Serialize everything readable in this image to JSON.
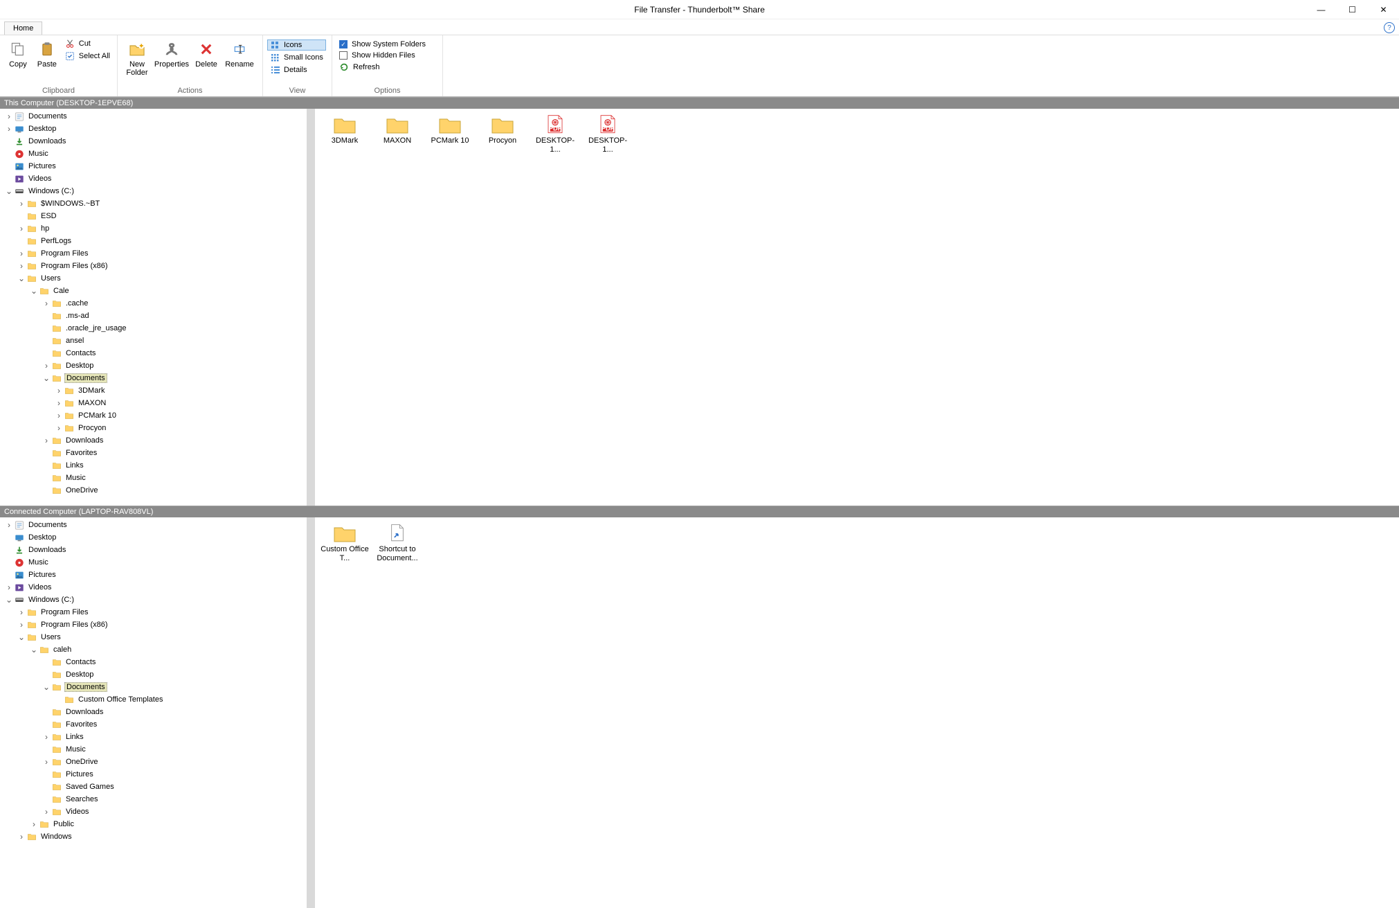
{
  "window": {
    "title": "File Transfer - Thunderbolt™ Share"
  },
  "tabs": {
    "home": "Home"
  },
  "ribbon": {
    "clipboard": {
      "label": "Clipboard",
      "copy": "Copy",
      "paste": "Paste",
      "cut": "Cut",
      "selectall": "Select All"
    },
    "actions": {
      "label": "Actions",
      "newfolder": "New\nFolder",
      "properties": "Properties",
      "delete": "Delete",
      "rename": "Rename"
    },
    "view": {
      "label": "View",
      "icons": "Icons",
      "small": "Small Icons",
      "details": "Details"
    },
    "options": {
      "label": "Options",
      "sysfolders": "Show System Folders",
      "hidden": "Show Hidden Files",
      "refresh": "Refresh"
    }
  },
  "panes": {
    "top": {
      "header": "This Computer (DESKTOP-1EPVE68)",
      "tree": [
        {
          "d": 0,
          "tw": ">",
          "ic": "lib-doc",
          "t": "Documents"
        },
        {
          "d": 0,
          "tw": ">",
          "ic": "lib-desk",
          "t": "Desktop"
        },
        {
          "d": 0,
          "tw": " ",
          "ic": "lib-dl",
          "t": "Downloads"
        },
        {
          "d": 0,
          "tw": " ",
          "ic": "lib-mus",
          "t": "Music"
        },
        {
          "d": 0,
          "tw": " ",
          "ic": "lib-pic",
          "t": "Pictures"
        },
        {
          "d": 0,
          "tw": " ",
          "ic": "lib-vid",
          "t": "Videos"
        },
        {
          "d": 0,
          "tw": "v",
          "ic": "drive",
          "t": "Windows (C:)"
        },
        {
          "d": 1,
          "tw": ">",
          "ic": "fold",
          "t": "$WINDOWS.~BT"
        },
        {
          "d": 1,
          "tw": " ",
          "ic": "fold",
          "t": "ESD"
        },
        {
          "d": 1,
          "tw": ">",
          "ic": "fold",
          "t": "hp"
        },
        {
          "d": 1,
          "tw": " ",
          "ic": "fold",
          "t": "PerfLogs"
        },
        {
          "d": 1,
          "tw": ">",
          "ic": "fold",
          "t": "Program Files"
        },
        {
          "d": 1,
          "tw": ">",
          "ic": "fold",
          "t": "Program Files (x86)"
        },
        {
          "d": 1,
          "tw": "v",
          "ic": "fold",
          "t": "Users"
        },
        {
          "d": 2,
          "tw": "v",
          "ic": "fold",
          "t": "Cale"
        },
        {
          "d": 3,
          "tw": ">",
          "ic": "fold",
          "t": ".cache"
        },
        {
          "d": 3,
          "tw": " ",
          "ic": "fold",
          "t": ".ms-ad"
        },
        {
          "d": 3,
          "tw": " ",
          "ic": "fold",
          "t": ".oracle_jre_usage"
        },
        {
          "d": 3,
          "tw": " ",
          "ic": "fold",
          "t": "ansel"
        },
        {
          "d": 3,
          "tw": " ",
          "ic": "fold",
          "t": "Contacts"
        },
        {
          "d": 3,
          "tw": ">",
          "ic": "fold",
          "t": "Desktop"
        },
        {
          "d": 3,
          "tw": "v",
          "ic": "fold",
          "t": "Documents",
          "sel": true
        },
        {
          "d": 4,
          "tw": ">",
          "ic": "fold",
          "t": "3DMark"
        },
        {
          "d": 4,
          "tw": ">",
          "ic": "fold",
          "t": "MAXON"
        },
        {
          "d": 4,
          "tw": ">",
          "ic": "fold",
          "t": "PCMark 10"
        },
        {
          "d": 4,
          "tw": ">",
          "ic": "fold",
          "t": "Procyon"
        },
        {
          "d": 3,
          "tw": ">",
          "ic": "fold",
          "t": "Downloads"
        },
        {
          "d": 3,
          "tw": " ",
          "ic": "fold",
          "t": "Favorites"
        },
        {
          "d": 3,
          "tw": " ",
          "ic": "fold",
          "t": "Links"
        },
        {
          "d": 3,
          "tw": " ",
          "ic": "fold",
          "t": "Music"
        },
        {
          "d": 3,
          "tw": " ",
          "ic": "fold",
          "t": "OneDrive"
        }
      ],
      "items": [
        {
          "ic": "fold",
          "t": "3DMark"
        },
        {
          "ic": "fold",
          "t": "MAXON"
        },
        {
          "ic": "fold",
          "t": "PCMark 10"
        },
        {
          "ic": "fold",
          "t": "Procyon"
        },
        {
          "ic": "pdf",
          "t": "DESKTOP-1..."
        },
        {
          "ic": "pdf",
          "t": "DESKTOP-1..."
        }
      ]
    },
    "bot": {
      "header": "Connected Computer (LAPTOP-RAV808VL)",
      "tree": [
        {
          "d": 0,
          "tw": ">",
          "ic": "lib-doc",
          "t": "Documents"
        },
        {
          "d": 0,
          "tw": " ",
          "ic": "lib-desk",
          "t": "Desktop"
        },
        {
          "d": 0,
          "tw": " ",
          "ic": "lib-dl",
          "t": "Downloads"
        },
        {
          "d": 0,
          "tw": " ",
          "ic": "lib-mus",
          "t": "Music"
        },
        {
          "d": 0,
          "tw": " ",
          "ic": "lib-pic",
          "t": "Pictures"
        },
        {
          "d": 0,
          "tw": ">",
          "ic": "lib-vid",
          "t": "Videos"
        },
        {
          "d": 0,
          "tw": "v",
          "ic": "drive",
          "t": "Windows (C:)"
        },
        {
          "d": 1,
          "tw": ">",
          "ic": "fold",
          "t": "Program Files"
        },
        {
          "d": 1,
          "tw": ">",
          "ic": "fold",
          "t": "Program Files (x86)"
        },
        {
          "d": 1,
          "tw": "v",
          "ic": "fold",
          "t": "Users"
        },
        {
          "d": 2,
          "tw": "v",
          "ic": "fold",
          "t": "caleh"
        },
        {
          "d": 3,
          "tw": " ",
          "ic": "fold",
          "t": "Contacts"
        },
        {
          "d": 3,
          "tw": " ",
          "ic": "fold",
          "t": "Desktop"
        },
        {
          "d": 3,
          "tw": "v",
          "ic": "fold",
          "t": "Documents",
          "sel": true
        },
        {
          "d": 4,
          "tw": " ",
          "ic": "fold",
          "t": "Custom Office Templates"
        },
        {
          "d": 3,
          "tw": " ",
          "ic": "fold",
          "t": "Downloads"
        },
        {
          "d": 3,
          "tw": " ",
          "ic": "fold",
          "t": "Favorites"
        },
        {
          "d": 3,
          "tw": ">",
          "ic": "fold",
          "t": "Links"
        },
        {
          "d": 3,
          "tw": " ",
          "ic": "fold",
          "t": "Music"
        },
        {
          "d": 3,
          "tw": ">",
          "ic": "fold",
          "t": "OneDrive"
        },
        {
          "d": 3,
          "tw": " ",
          "ic": "fold",
          "t": "Pictures"
        },
        {
          "d": 3,
          "tw": " ",
          "ic": "fold",
          "t": "Saved Games"
        },
        {
          "d": 3,
          "tw": " ",
          "ic": "fold",
          "t": "Searches"
        },
        {
          "d": 3,
          "tw": ">",
          "ic": "fold",
          "t": "Videos"
        },
        {
          "d": 2,
          "tw": ">",
          "ic": "fold",
          "t": "Public"
        },
        {
          "d": 1,
          "tw": ">",
          "ic": "fold",
          "t": "Windows"
        }
      ],
      "items": [
        {
          "ic": "fold",
          "t": "Custom Office T..."
        },
        {
          "ic": "shortcut",
          "t": "Shortcut to Document..."
        }
      ]
    }
  }
}
